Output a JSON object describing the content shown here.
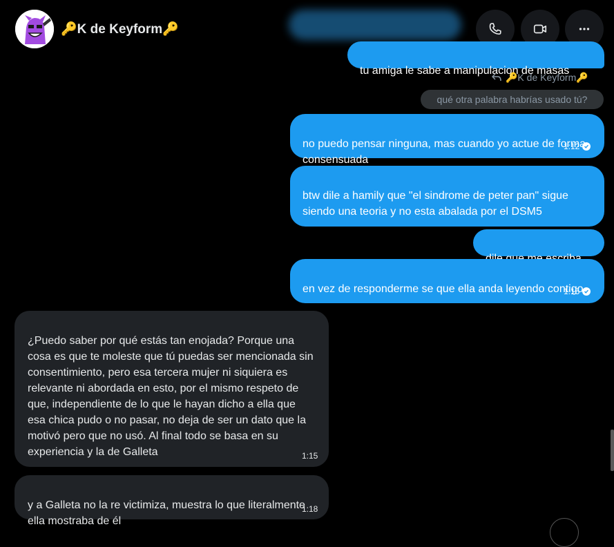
{
  "header": {
    "title": "🔑K de Keyform🔑",
    "call_icon": "phone-icon",
    "video_icon": "video-icon",
    "more_icon": "more-icon"
  },
  "messages": {
    "blurred_top": "",
    "m1": {
      "text": "tu amiga le sabe a manipulacion de masas"
    },
    "reply_ref": "🔑K de Keyform🔑",
    "reply_quote": "qué otra palabra habrías usado tú?",
    "m2": {
      "text": "no puedo pensar ninguna, mas cuando yo actue de forma consensuada",
      "time": "1:12"
    },
    "m3": {
      "text": "btw dile a hamily que \"el sindrome de peter pan\" sigue siendo una teoria y no esta abalada por el DSM5"
    },
    "m4": {
      "text": "dile que me escriba"
    },
    "m5": {
      "text": "en vez de responderme se que ella anda leyendo contigo",
      "time": "1:15"
    },
    "m6": {
      "text": "¿Puedo saber por qué estás tan enojada? Porque una cosa es que te moleste que tú puedas ser mencionada sin consentimiento, pero esa tercera mujer ni siquiera es relevante ni abordada en esto, por el mismo respeto de que, independiente de lo que le hayan dicho a ella que esa chica pudo o no pasar, no deja de ser un dato que la motivó pero que no usó. Al final todo se basa en su experiencia y la de Galleta",
      "time": "1:15"
    },
    "m7": {
      "text": "y a Galleta no la re victimiza, muestra lo que literalmente ella mostraba de él",
      "time": "1:18"
    }
  },
  "colors": {
    "outgoing": "#1d9bf0",
    "incoming": "#202327",
    "background": "#000000"
  }
}
